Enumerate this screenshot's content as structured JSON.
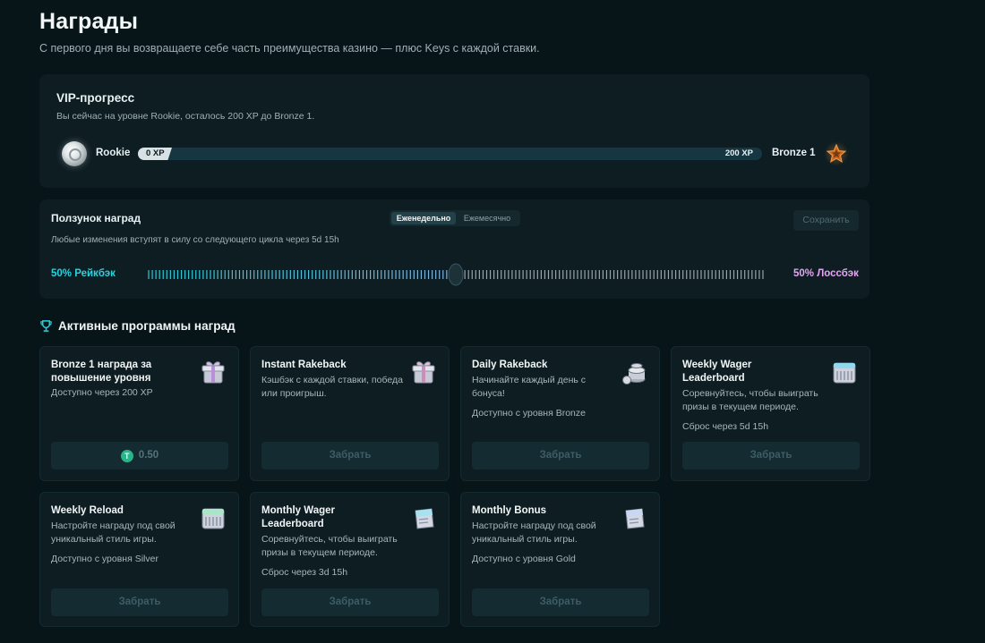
{
  "page": {
    "title": "Награды",
    "subtitle": "С первого дня вы возвращаете себе часть преимущества казино — плюс Keys с каждой ставки."
  },
  "vip": {
    "title": "VIP-прогресс",
    "description": "Вы сейчас на уровне Rookie, осталось 200 XP до Bronze 1.",
    "current_level": "Rookie",
    "next_level": "Bronze 1",
    "current_xp": "0 XP",
    "target_xp": "200 XP",
    "progress_fraction": 0
  },
  "slider": {
    "title": "Ползунок наград",
    "tabs": [
      "Еженедельно",
      "Ежемесячно"
    ],
    "active_tab": "Еженедельно",
    "save_label": "Сохранить",
    "description": "Любые изменения вступят в силу со следующего цикла через 5d 15h",
    "left_label": "50% Рейкбэк",
    "right_label": "50% Лоссбэк",
    "value_fraction": 0.5
  },
  "programs": {
    "title": "Активные программы наград",
    "cards": [
      {
        "title": "Bronze 1 награда за повышение уровня",
        "description": "",
        "availability": "Доступно через 200 XP",
        "button_label": "0.50",
        "icon": "gift-box-icon"
      },
      {
        "title": "Instant Rakeback",
        "description": "Кэшбэк с каждой ставки, победа или проигрыш.",
        "availability": "",
        "button_label": "Забрать",
        "icon": "gift-box-icon"
      },
      {
        "title": "Daily Rakeback",
        "description": "Начинайте каждый день с бонуса!",
        "availability": "Доступно с уровня Bronze",
        "button_label": "Забрать",
        "icon": "coin-stack-icon"
      },
      {
        "title": "Weekly Wager Leaderboard",
        "description": "Соревнуйтесь, чтобы выиграть призы в текущем периоде.",
        "availability": "Сброс через 5d 15h",
        "button_label": "Забрать",
        "icon": "calendar-icon"
      },
      {
        "title": "Weekly Reload",
        "description": "Настройте награду под свой уникальный стиль игры.",
        "availability": "Доступно с уровня Silver",
        "button_label": "Забрать",
        "icon": "calendar-icon"
      },
      {
        "title": "Monthly Wager Leaderboard",
        "description": "Соревнуйтесь, чтобы выиграть призы в текущем периоде.",
        "availability": "Сброс через 3d 15h",
        "button_label": "Забрать",
        "icon": "gift-card-icon"
      },
      {
        "title": "Monthly Bonus",
        "description": "Настройте награду под свой уникальный стиль игры.",
        "availability": "Доступно с уровня Gold",
        "button_label": "Забрать",
        "icon": "gift-card-icon"
      }
    ]
  },
  "colors": {
    "background": "#071418",
    "panel": "#0d1d22",
    "rakeback": "#29d3e0",
    "lossback": "#e8a3f5",
    "coin": "#29b58a"
  }
}
